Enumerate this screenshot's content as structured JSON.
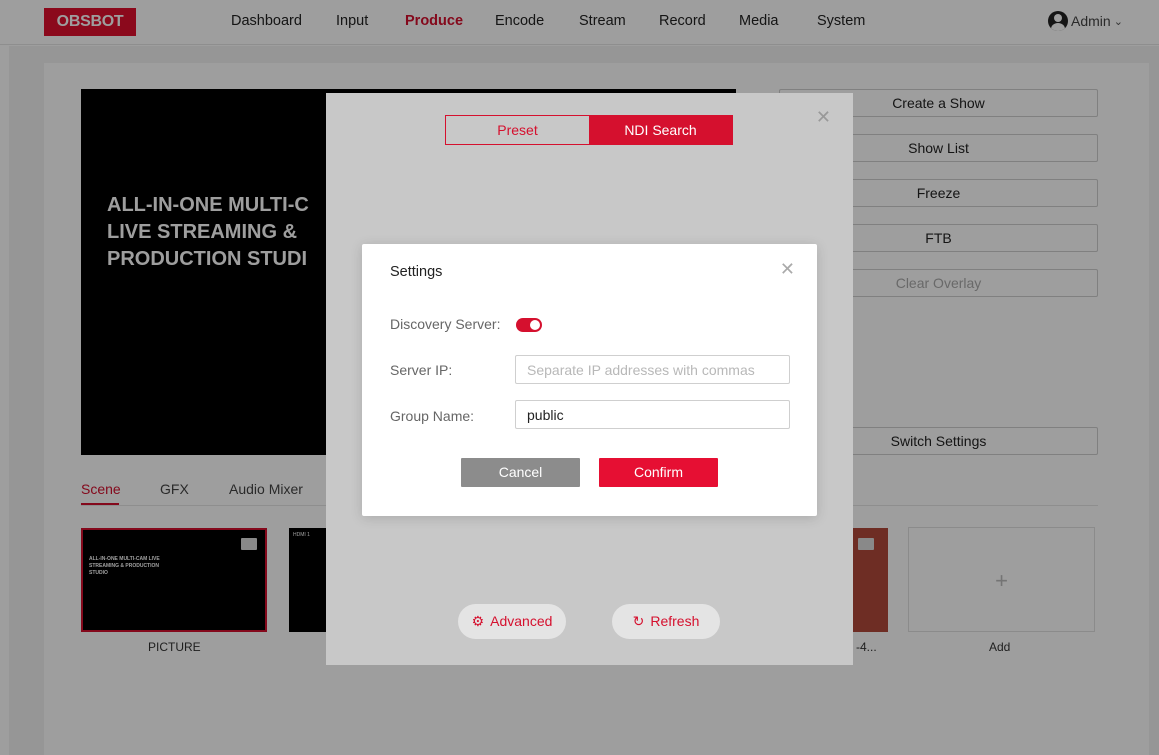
{
  "header": {
    "logo": "OBSBOT",
    "nav": [
      "Dashboard",
      "Input",
      "Produce",
      "Encode",
      "Stream",
      "Record",
      "Media",
      "System"
    ],
    "active_nav": "Produce",
    "user": "Admin"
  },
  "preview": {
    "text_line1": "ALL-IN-ONE MULTI-C",
    "text_line2": "LIVE STREAMING &",
    "text_line3": "PRODUCTION STUDI"
  },
  "right_panel": {
    "create_show": "Create a Show",
    "show_list": "Show List",
    "freeze": "Freeze",
    "ftb": "FTB",
    "clear_overlay": "Clear Overlay",
    "switch_settings": "Switch Settings"
  },
  "tabs": [
    "Scene",
    "GFX",
    "Audio Mixer"
  ],
  "scenes": {
    "picture_label": "PICTURE",
    "picture_thumb_text": "ALL-IN-ONE MULTI-CAM LIVE STREAMING & PRODUCTION STUDIO",
    "hdmi_thumb_text": "HDMI 1",
    "truncated_label": "-4...",
    "add_label": "Add",
    "add_symbol": "+"
  },
  "ndi_modal": {
    "seg_preset": "Preset",
    "seg_ndi": "NDI Search",
    "advanced": "Advanced",
    "refresh": "Refresh"
  },
  "settings_dialog": {
    "title": "Settings",
    "discovery_label": "Discovery Server:",
    "discovery_enabled": true,
    "server_ip_label": "Server IP:",
    "server_ip_placeholder": "Separate IP addresses with commas",
    "server_ip_value": "",
    "group_name_label": "Group Name:",
    "group_name_value": "public",
    "cancel": "Cancel",
    "confirm": "Confirm"
  },
  "colors": {
    "brand": "#d5102e",
    "confirm": "#e60f33",
    "cancel": "#8c8c8c"
  }
}
